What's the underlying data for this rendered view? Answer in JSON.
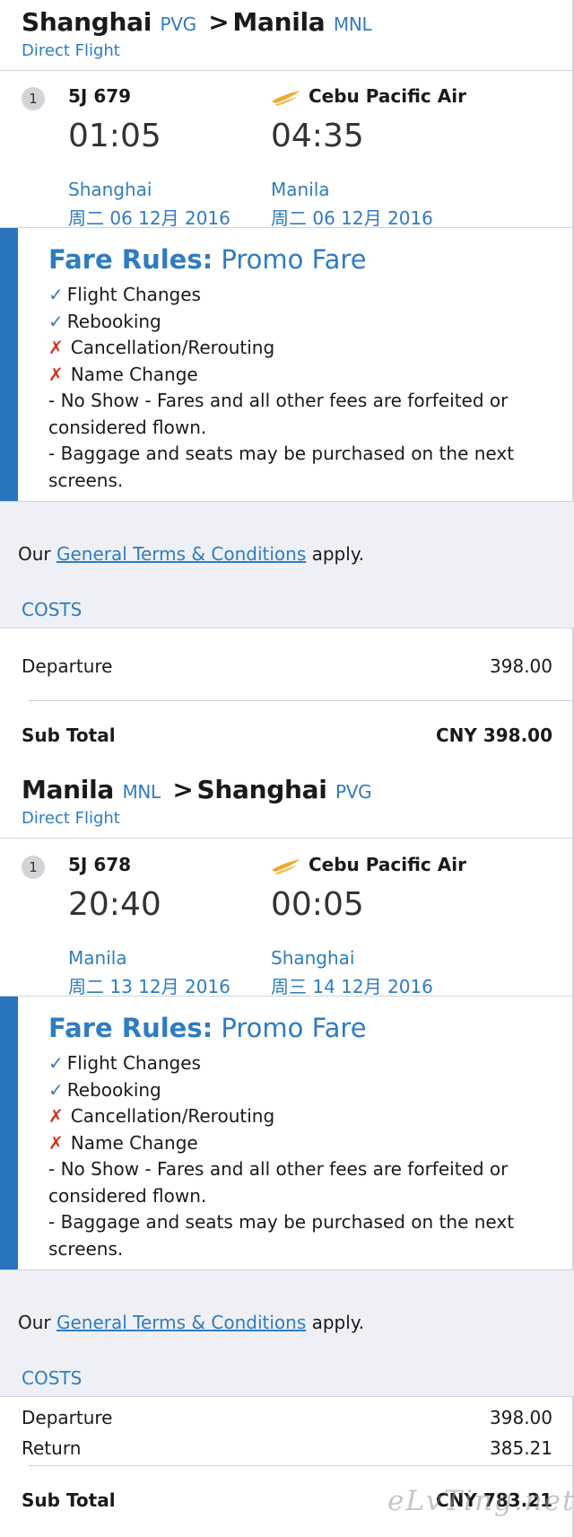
{
  "outbound": {
    "from_city": "Shanghai",
    "from_code": "PVG",
    "arrow": ">",
    "to_city": "Manila",
    "to_code": "MNL",
    "flight_type": "Direct Flight",
    "segment_number": "1",
    "flight_no": "5J 679",
    "airline": "Cebu Pacific Air",
    "depart_time": "01:05",
    "arrive_time": "04:35",
    "depart_city": "Shanghai",
    "arrive_city": "Manila",
    "depart_date": "周二 06 12月 2016",
    "arrive_date": "周二 06 12月 2016",
    "fare_rules_label": "Fare Rules:",
    "fare_name": "Promo Fare",
    "rules": {
      "r1": "Flight Changes",
      "r2": "Rebooking",
      "r3": "Cancellation/Rerouting",
      "r4": "Name Change",
      "r5": "-  No Show - Fares and all other fees are forfeited or considered flown.",
      "r6": "-  Baggage and seats may be purchased on the next screens."
    },
    "terms_prefix": "Our",
    "terms_link": "General Terms & Conditions",
    "terms_suffix": "apply.",
    "costs_label": "COSTS",
    "departure_label": "Departure",
    "departure_value": "398.00",
    "subtotal_label": "Sub Total",
    "subtotal_value": "CNY 398.00"
  },
  "return": {
    "from_city": "Manila",
    "from_code": "MNL",
    "arrow": ">",
    "to_city": "Shanghai",
    "to_code": "PVG",
    "flight_type": "Direct Flight",
    "segment_number": "1",
    "flight_no": "5J 678",
    "airline": "Cebu Pacific Air",
    "depart_time": "20:40",
    "arrive_time": "00:05",
    "depart_city": "Manila",
    "arrive_city": "Shanghai",
    "depart_date": "周二 13 12月 2016",
    "arrive_date": "周三 14 12月 2016",
    "fare_rules_label": "Fare Rules:",
    "fare_name": "Promo Fare",
    "rules": {
      "r1": "Flight Changes",
      "r2": "Rebooking",
      "r3": "Cancellation/Rerouting",
      "r4": "Name Change",
      "r5": "-  No Show - Fares and all other fees are forfeited or considered flown.",
      "r6": "-  Baggage and seats may be purchased on the next screens."
    },
    "terms_prefix": "Our",
    "terms_link": "General Terms & Conditions",
    "terms_suffix": "apply.",
    "costs_label": "COSTS",
    "departure_label": "Departure",
    "departure_value": "398.00",
    "return_label": "Return",
    "return_value": "385.21",
    "subtotal_label": "Sub Total",
    "subtotal_value": "CNY 783.21"
  },
  "icons": {
    "allowed": "checkmark-icon",
    "not_allowed": "cross-icon",
    "airline_logo": "cebu-pacific-logo-icon"
  },
  "colors": {
    "accent_blue": "#2f7cc0",
    "fare_bar": "#2874bd",
    "cross_red": "#d4321c",
    "airline_orange": "#f5a623"
  },
  "watermark": "eLvTing.net"
}
